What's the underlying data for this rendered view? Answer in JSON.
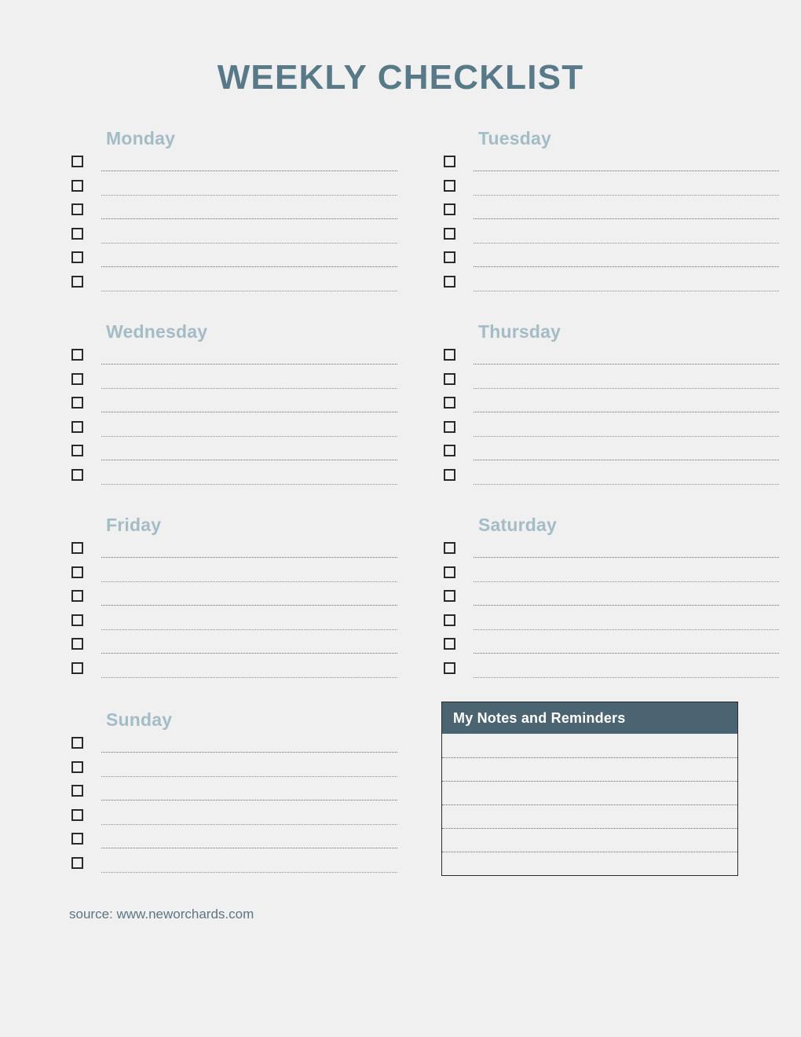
{
  "page": {
    "title": "WEEKLY CHECKLIST",
    "background_color": "#f0f0f0",
    "title_color": "#587a88",
    "day_header_color": "#a3bcc6",
    "notes_header_color": "#4b6472",
    "checkbox_border_color": "#2b2b2b"
  },
  "days": [
    {
      "label": "Monday",
      "column": "left",
      "rows": 6
    },
    {
      "label": "Tuesday",
      "column": "right",
      "rows": 6
    },
    {
      "label": "Wednesday",
      "column": "left",
      "rows": 6
    },
    {
      "label": "Thursday",
      "column": "right",
      "rows": 6
    },
    {
      "label": "Friday",
      "column": "left",
      "rows": 6
    },
    {
      "label": "Saturday",
      "column": "right",
      "rows": 6
    },
    {
      "label": "Sunday",
      "column": "left",
      "rows": 6
    }
  ],
  "notes": {
    "header": "My Notes and Reminders",
    "rows": 6
  },
  "footer": {
    "source": "source: www.neworchards.com"
  }
}
